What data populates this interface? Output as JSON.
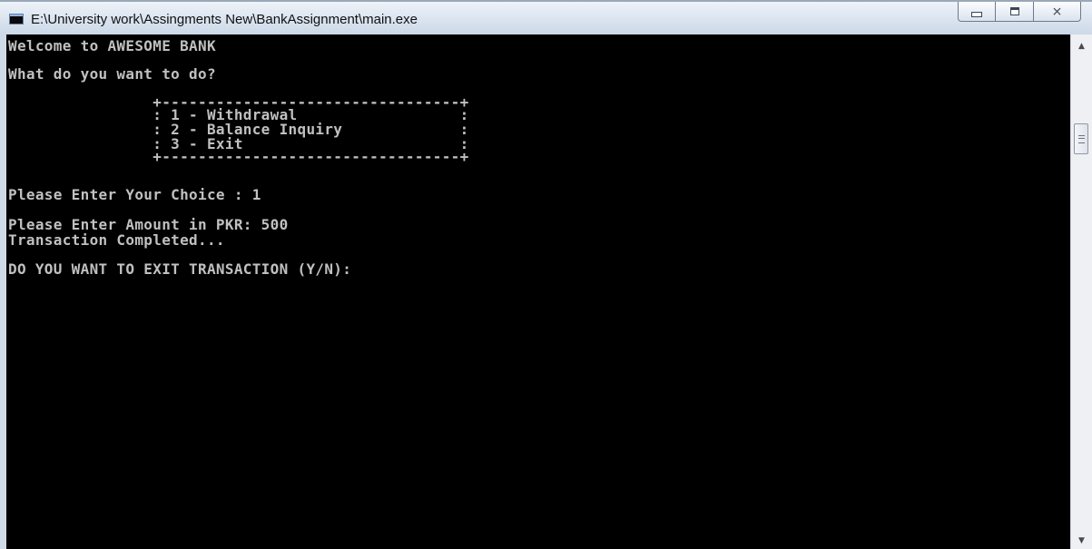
{
  "window": {
    "title": "E:\\University work\\Assingments New\\BankAssignment\\main.exe",
    "icon": "console-app-icon",
    "controls": {
      "minimize": "minimize-icon",
      "maximize": "maximize-icon",
      "close_symbol": "⨯"
    }
  },
  "console": {
    "lines": [
      "Welcome to AWESOME BANK",
      "What do you want to do?",
      "                +---------------------------------+",
      "                : 1 - Withdrawal                  :",
      "                : 2 - Balance Inquiry             :",
      "                : 3 - Exit                        :",
      "                +---------------------------------+",
      "Please Enter Your Choice : 1",
      "Please Enter Amount in PKR: 500",
      "Transaction Completed...",
      "DO YOU WANT TO EXIT TRANSACTION (Y/N):"
    ]
  },
  "scrollbar": {
    "up_symbol": "▲",
    "down_symbol": "▼"
  },
  "colors": {
    "console_bg": "#000000",
    "console_text": "#c0c0c0",
    "titlebar": "#dde6f1"
  }
}
